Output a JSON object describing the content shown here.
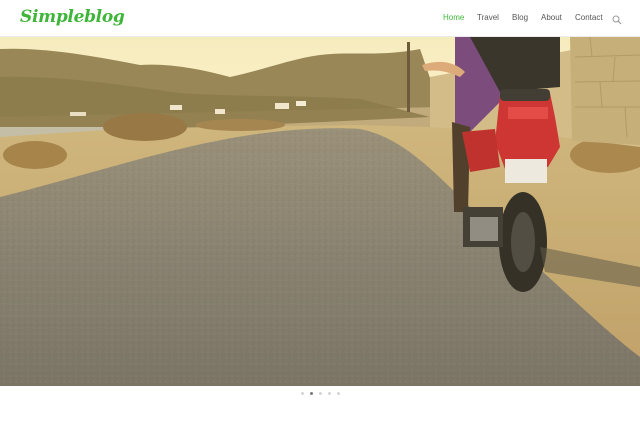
{
  "site": {
    "logo_text": "Simpleblog"
  },
  "nav": {
    "items": [
      {
        "label": "Home",
        "active": true
      },
      {
        "label": "Travel",
        "active": false
      },
      {
        "label": "Blog",
        "active": false
      },
      {
        "label": "About",
        "active": false
      },
      {
        "label": "Contact",
        "active": false
      }
    ],
    "search_icon": "search-icon"
  },
  "colors": {
    "brand_green": "#3fb53a",
    "nav_text": "#555555",
    "slider_dot": "#d6d6d6",
    "slider_dot_active": "#7a7a7a"
  },
  "hero": {
    "image_subject": "rider on red scooter on a sunlit rural road beside stone wall",
    "icon": "hero-photo"
  },
  "slider": {
    "total_slides": 5,
    "active_slide": 2
  }
}
